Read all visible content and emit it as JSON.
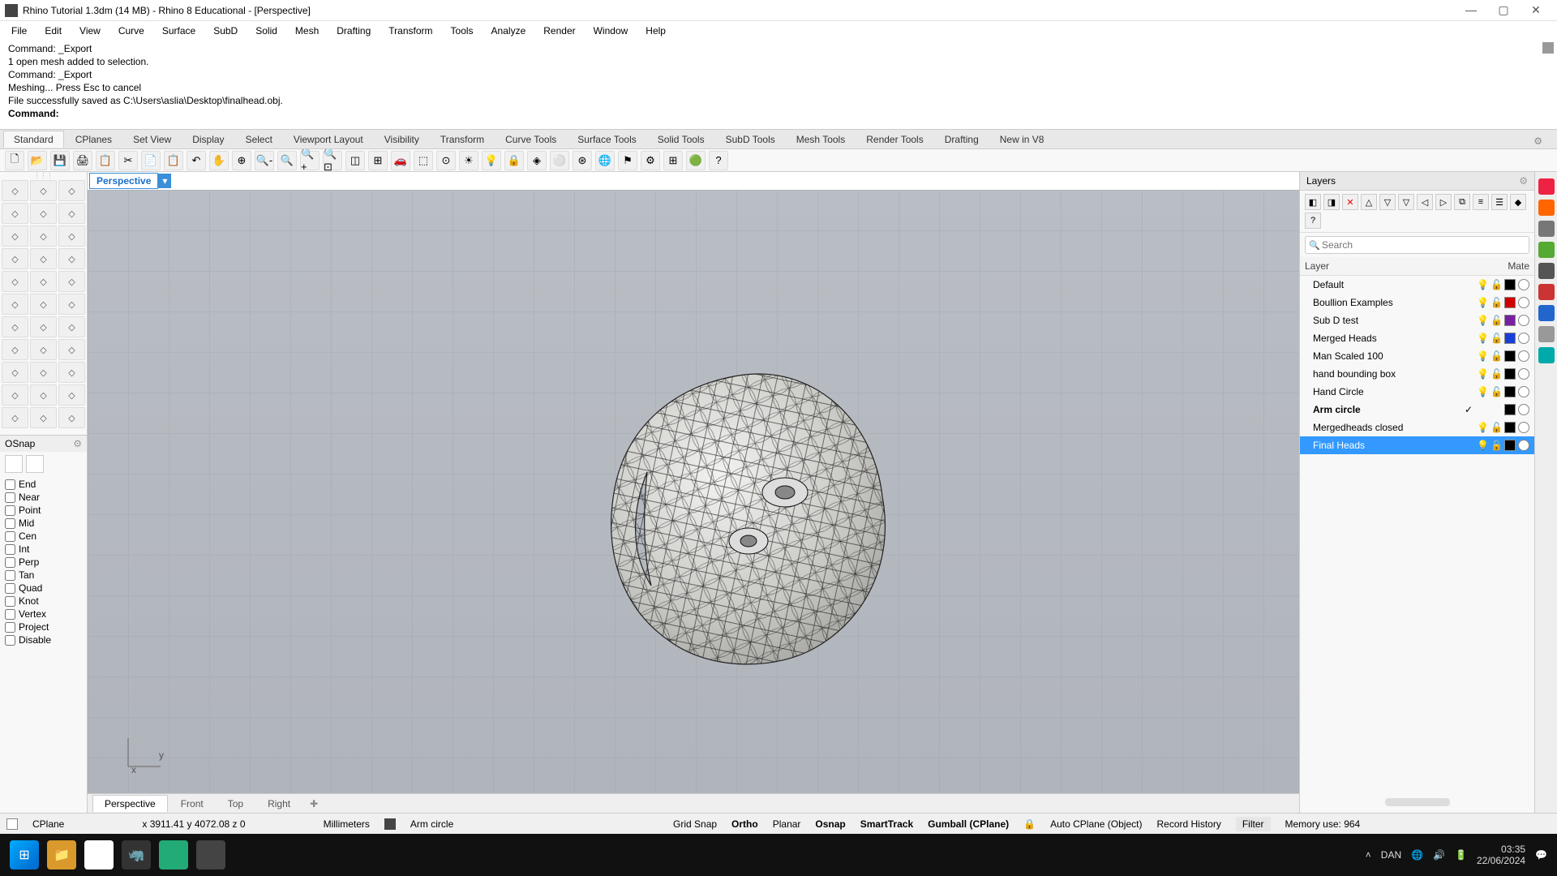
{
  "title": "Rhino Tutorial 1.3dm (14 MB) - Rhino 8 Educational - [Perspective]",
  "menus": [
    "File",
    "Edit",
    "View",
    "Curve",
    "Surface",
    "SubD",
    "Solid",
    "Mesh",
    "Drafting",
    "Transform",
    "Tools",
    "Analyze",
    "Render",
    "Window",
    "Help"
  ],
  "command_history": [
    "Command: _Export",
    "1 open mesh added to selection.",
    "Command: _Export",
    "Meshing... Press Esc to cancel",
    "File successfully saved as C:\\Users\\aslia\\Desktop\\finalhead.obj."
  ],
  "command_prompt": "Command:",
  "toolbar_tabs": [
    "Standard",
    "CPlanes",
    "Set View",
    "Display",
    "Select",
    "Viewport Layout",
    "Visibility",
    "Transform",
    "Curve Tools",
    "Surface Tools",
    "Solid Tools",
    "SubD Tools",
    "Mesh Tools",
    "Render Tools",
    "Drafting",
    "New in V8"
  ],
  "toolbar_tabs_active": 0,
  "viewport": {
    "title": "Perspective"
  },
  "viewport_tabs": [
    "Perspective",
    "Front",
    "Top",
    "Right"
  ],
  "viewport_tabs_active": 0,
  "osnap": {
    "title": "OSnap",
    "items": [
      "End",
      "Near",
      "Point",
      "Mid",
      "Cen",
      "Int",
      "Perp",
      "Tan",
      "Quad",
      "Knot",
      "Vertex",
      "Project",
      "Disable"
    ]
  },
  "layers": {
    "title": "Layers",
    "search_placeholder": "Search",
    "columns": {
      "name": "Layer",
      "material": "Mate"
    },
    "items": [
      {
        "name": "Default",
        "color": "#000000",
        "bulb": true,
        "lock": true
      },
      {
        "name": "Boullion Examples",
        "color": "#d10000",
        "bulb": true,
        "lock": true
      },
      {
        "name": "Sub D test",
        "color": "#7a1fa2",
        "bulb": true,
        "lock": true
      },
      {
        "name": "Merged Heads",
        "color": "#1a3fd6",
        "bulb": true,
        "lock": true
      },
      {
        "name": "Man Scaled 100",
        "color": "#000000",
        "bulb": true,
        "lock": true
      },
      {
        "name": "hand bounding box",
        "color": "#000000",
        "bulb": true,
        "lock": true
      },
      {
        "name": "Hand Circle",
        "color": "#000000",
        "bulb": true,
        "lock": true
      },
      {
        "name": "Arm circle",
        "color": "#000000",
        "current": true,
        "bulb": false,
        "lock": false
      },
      {
        "name": "Mergedheads closed",
        "color": "#000000",
        "bulb": true,
        "lock": true
      },
      {
        "name": "Final Heads",
        "color": "#000000",
        "selected": true,
        "bulb": true,
        "lock": true
      }
    ]
  },
  "status": {
    "cplane": "CPlane",
    "coords": "x 3911.41  y 4072.08  z 0",
    "units": "Millimeters",
    "layer": "Arm circle",
    "toggles": [
      "Grid Snap",
      "Ortho",
      "Planar",
      "Osnap",
      "SmartTrack",
      "Gumball (CPlane)"
    ],
    "toggles_active": [
      1,
      3,
      4,
      5
    ],
    "auto_cplane": "Auto CPlane (Object)",
    "record": "Record History",
    "filter": "Filter",
    "memory": "Memory use: 964"
  },
  "taskbar": {
    "lang": "DAN",
    "time": "03:35",
    "date": "22/06/2024"
  }
}
